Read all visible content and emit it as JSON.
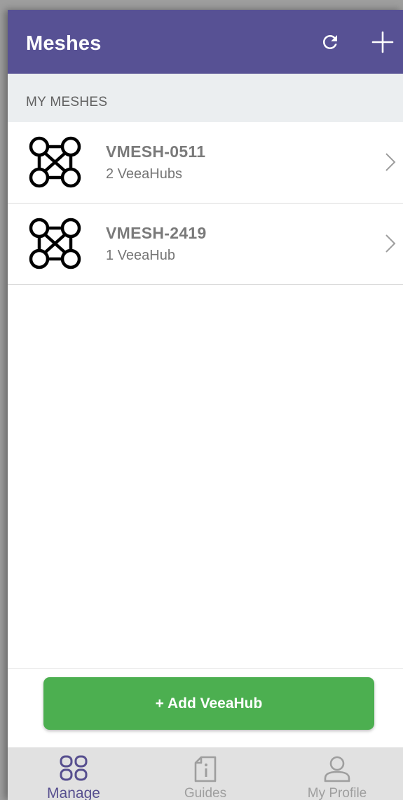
{
  "header": {
    "title": "Meshes",
    "refresh_icon": "refresh-icon",
    "add_icon": "plus-icon"
  },
  "section": {
    "label": "MY MESHES"
  },
  "meshes": [
    {
      "name": "VMESH-0511",
      "count": "2 VeeaHubs"
    },
    {
      "name": "VMESH-2419",
      "count": "1 VeeaHub"
    }
  ],
  "add_button": {
    "label": "+ Add VeeaHub"
  },
  "tabs": [
    {
      "label": "Manage",
      "icon": "grid-icon",
      "active": true
    },
    {
      "label": "Guides",
      "icon": "document-info-icon",
      "active": false
    },
    {
      "label": "My Profile",
      "icon": "user-icon",
      "active": false
    }
  ],
  "colors": {
    "header": "#575194",
    "accent_green": "#4caf50",
    "active_tab": "#574f8f",
    "inactive_tab": "#9e9e9e"
  }
}
